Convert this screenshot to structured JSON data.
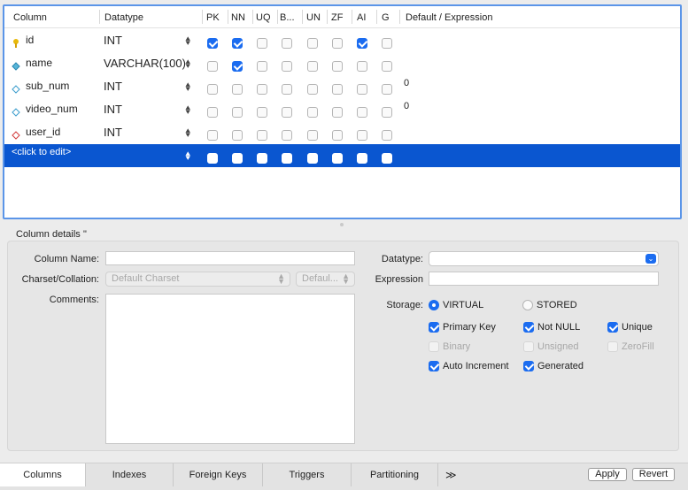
{
  "grid": {
    "headers": {
      "column": "Column",
      "datatype": "Datatype",
      "pk": "PK",
      "nn": "NN",
      "uq": "UQ",
      "b": "B...",
      "un": "UN",
      "zf": "ZF",
      "ai": "AI",
      "g": "G",
      "default": "Default / Expression"
    },
    "rows": [
      {
        "name": "id",
        "datatype": "INT",
        "icon": "primary-key-icon",
        "default": ""
      },
      {
        "name": "name",
        "datatype": "VARCHAR(100)",
        "icon": "column-not-null-icon",
        "default": ""
      },
      {
        "name": "sub_num",
        "datatype": "INT",
        "icon": "column-icon",
        "default": "0"
      },
      {
        "name": "video_num",
        "datatype": "INT",
        "icon": "column-icon",
        "default": "0"
      },
      {
        "name": "user_id",
        "datatype": "INT",
        "icon": "foreign-key-icon",
        "default": ""
      }
    ],
    "placeholder_row": "<click to edit>",
    "checks": [
      [
        true,
        true,
        false,
        false,
        false,
        false,
        true,
        false
      ],
      [
        false,
        true,
        false,
        false,
        false,
        false,
        false,
        false
      ],
      [
        false,
        false,
        false,
        false,
        false,
        false,
        false,
        false
      ],
      [
        false,
        false,
        false,
        false,
        false,
        false,
        false,
        false
      ],
      [
        false,
        false,
        false,
        false,
        false,
        false,
        false,
        false
      ],
      [
        false,
        false,
        false,
        false,
        false,
        false,
        false,
        false
      ]
    ],
    "colors": {
      "selection": "#0a56d0",
      "checked": "#1b6cf0",
      "focus_border": "#5b95e8"
    }
  },
  "details": {
    "title": "Column details ''",
    "column_name_label": "Column Name:",
    "column_name_value": "",
    "charset_label": "Charset/Collation:",
    "charset_value": "Default Charset",
    "collation_value": "Defaul...",
    "comments_label": "Comments:",
    "datatype_label": "Datatype:",
    "expression_label": "Expression",
    "storage_label": "Storage:",
    "storage_virtual": "VIRTUAL",
    "storage_stored": "STORED",
    "primary_key": "Primary Key",
    "not_null": "Not NULL",
    "unique": "Unique",
    "binary": "Binary",
    "unsigned": "Unsigned",
    "zerofill": "ZeroFill",
    "auto_increment": "Auto Increment",
    "generated": "Generated"
  },
  "tabs": [
    "Columns",
    "Indexes",
    "Foreign Keys",
    "Triggers",
    "Partitioning"
  ],
  "more_tabs": "≫",
  "buttons": {
    "apply": "Apply",
    "revert": "Revert"
  }
}
